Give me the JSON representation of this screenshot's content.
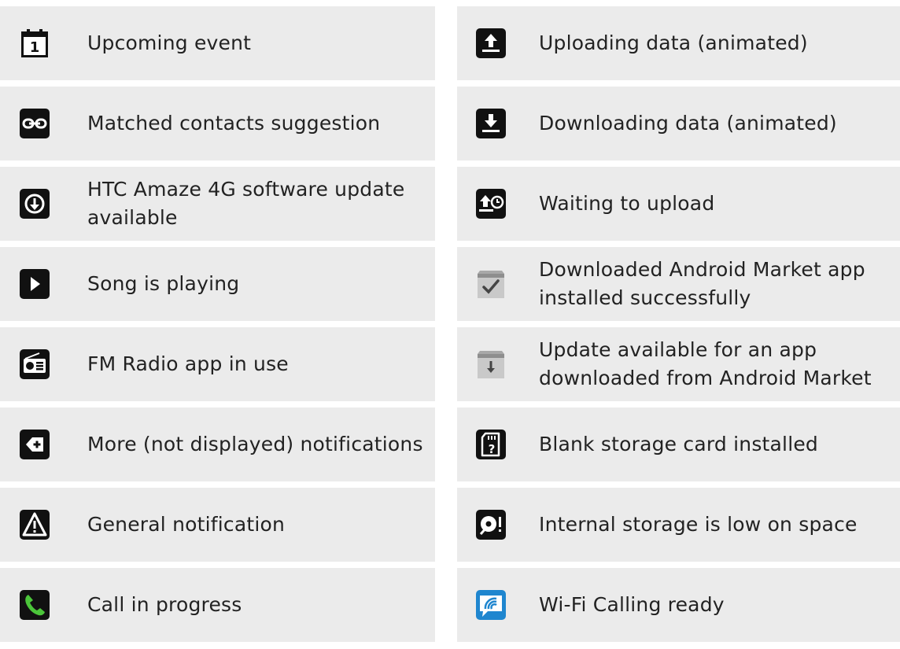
{
  "left_column": [
    {
      "icon": "calendar-icon",
      "label": "Upcoming event"
    },
    {
      "icon": "matched-contacts-icon",
      "label": "Matched contacts suggestion"
    },
    {
      "icon": "software-update-icon",
      "label": "HTC Amaze 4G software update available"
    },
    {
      "icon": "play-icon",
      "label": "Song is playing"
    },
    {
      "icon": "fm-radio-icon",
      "label": "FM Radio app in use"
    },
    {
      "icon": "more-notifications-icon",
      "label": "More (not displayed) notifications"
    },
    {
      "icon": "warning-icon",
      "label": "General notification"
    },
    {
      "icon": "phone-call-icon",
      "label": "Call in progress"
    }
  ],
  "right_column": [
    {
      "icon": "upload-icon",
      "label": "Uploading data (animated)"
    },
    {
      "icon": "download-icon",
      "label": "Downloading data (animated)"
    },
    {
      "icon": "waiting-upload-icon",
      "label": "Waiting to upload"
    },
    {
      "icon": "market-installed-icon",
      "label": "Downloaded Android Market app installed successfully"
    },
    {
      "icon": "market-update-icon",
      "label": "Update available for an app downloaded from Android Market"
    },
    {
      "icon": "blank-sd-card-icon",
      "label": "Blank storage card installed"
    },
    {
      "icon": "low-storage-icon",
      "label": "Internal storage is low on space"
    },
    {
      "icon": "wifi-calling-icon",
      "label": "Wi-Fi Calling ready"
    }
  ]
}
